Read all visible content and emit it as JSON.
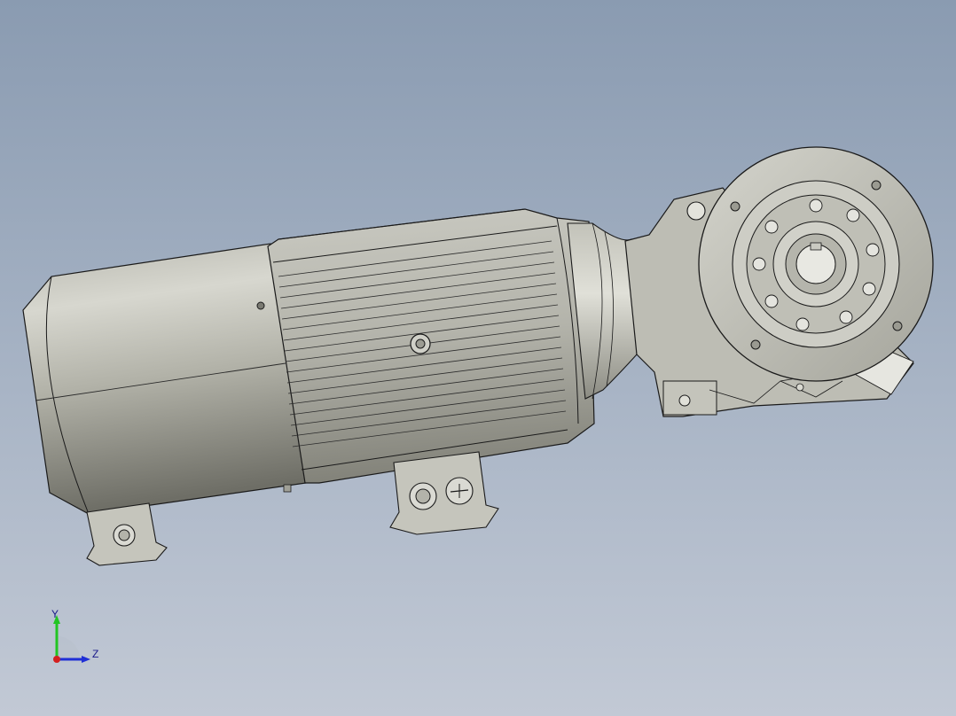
{
  "viewport": {
    "background_top": "#8a9bb1",
    "background_bottom": "#c2c9d5"
  },
  "model": {
    "body_color": "#c8c8bf",
    "edge_color": "#1a1a1a",
    "shade_color": "#6f6f66"
  },
  "triad": {
    "y_label": "Y",
    "z_label": "Z",
    "y_color": "#22c522",
    "z_color": "#1f2fd6",
    "x_color": "#d41f1f"
  }
}
